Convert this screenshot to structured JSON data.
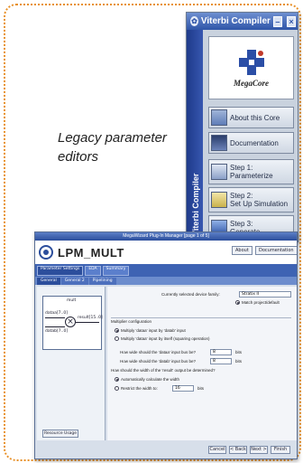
{
  "caption": "Legacy parameter editors",
  "viterbi": {
    "title": "Viterbi Compiler",
    "side_label": "Viterbi Compiler",
    "logo_text": "MegaCore",
    "buttons": [
      {
        "label": "About this Core",
        "icon": "info-book-icon"
      },
      {
        "label": "Documentation",
        "icon": "book-icon"
      },
      {
        "label": "Step 1:\nParameterize",
        "icon": "wrench-icon"
      },
      {
        "label": "Step 2:\nSet Up Simulation",
        "icon": "waveform-icon"
      },
      {
        "label": "Step 3:\nGenerate",
        "icon": "gear-icon"
      }
    ]
  },
  "mega": {
    "title": "MegaWizard Plug-In Manager [page 1 of 5]",
    "name": "LPM_MULT",
    "about": "About",
    "documentation": "Documentation",
    "steps": [
      "Parameter Settings",
      "EDA",
      "Summary"
    ],
    "tabs": [
      "General",
      "General 2",
      "Pipelining"
    ],
    "symbol": {
      "title": "mult",
      "in_a": "dataa[7..0]",
      "in_b": "datab[7..0]",
      "out": "result[15..0]"
    },
    "resource_button": "Resource Usage",
    "device_label": "Currently selected device family:",
    "device_value": "Stratix II",
    "match_default": "Match project/default",
    "mult_config": "Multiplier configuration",
    "opt1": "Multiply 'dataa' input by 'datab' input",
    "opt2": "Multiply 'dataa' input by itself (squaring operation)",
    "width_a_q": "How wide should the 'dataa' input bus be?",
    "width_b_q": "How wide should the 'datab' input bus be?",
    "width_a_val": "8",
    "width_b_val": "8",
    "bits": "bits",
    "result_q": "How should the width of the 'result' output be determined?",
    "auto_calc": "Automatically calculate the width",
    "restrict": "Restrict the width to:",
    "restrict_val": "16",
    "footer": {
      "cancel": "Cancel",
      "back": "< Back",
      "next": "Next >",
      "finish": "Finish"
    }
  }
}
